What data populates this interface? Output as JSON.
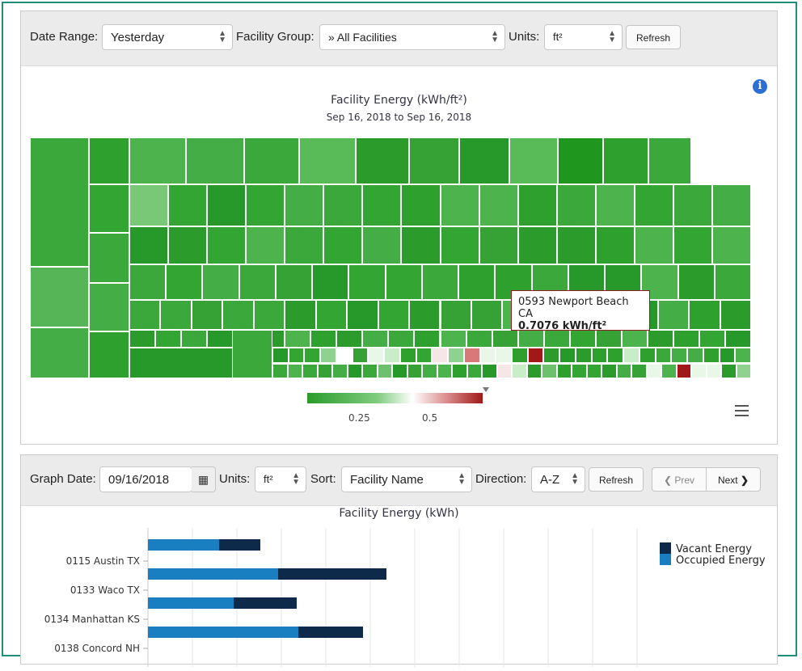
{
  "filters": {
    "date_range_label": "Date Range:",
    "date_range_value": "Yesterday",
    "facility_group_label": "Facility Group:",
    "facility_group_value": "» All Facilities",
    "units_label": "Units:",
    "units_value": "ft²",
    "refresh_label": "Refresh"
  },
  "treemap": {
    "title": "Facility Energy (kWh/ft²)",
    "subtitle": "Sep 16, 2018 to Sep 16, 2018",
    "tooltip_name": "0593 Newport Beach CA",
    "tooltip_value": "0.7076 kWh/ft²",
    "legend_ticks": [
      "0.25",
      "0.5"
    ],
    "colors": {
      "green": "#2a9b2a",
      "red": "#a01818"
    }
  },
  "graph": {
    "date_label": "Graph Date:",
    "date_value": "09/16/2018",
    "units_label": "Units:",
    "units_value": "ft²",
    "sort_label": "Sort:",
    "sort_value": "Facility Name",
    "direction_label": "Direction:",
    "direction_value": "A-Z",
    "refresh_label": "Refresh",
    "prev_label": "Prev",
    "next_label": "Next"
  },
  "chart_data": {
    "type": "bar",
    "title": "Facility Energy (kWh)",
    "categories": [
      "0115 Austin TX",
      "0133 Waco TX",
      "0134 Manhattan KS",
      "0138 Concord NH"
    ],
    "series": [
      {
        "name": "Occupied Energy",
        "values": [
          88,
          161,
          106,
          186
        ],
        "color": "#1a7fc1"
      },
      {
        "name": "Vacant Energy",
        "values": [
          51,
          134,
          78,
          80
        ],
        "color": "#0e2a4a"
      }
    ]
  }
}
